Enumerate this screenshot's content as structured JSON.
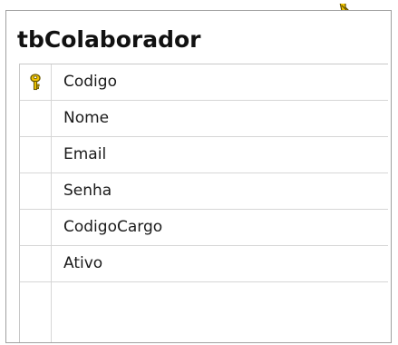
{
  "table": {
    "title": "tbColaborador",
    "columns": [
      {
        "name": "Codigo",
        "primary_key": true,
        "icon": "key-icon"
      },
      {
        "name": "Nome",
        "primary_key": false
      },
      {
        "name": "Email",
        "primary_key": false
      },
      {
        "name": "Senha",
        "primary_key": false
      },
      {
        "name": "CodigoCargo",
        "primary_key": false
      },
      {
        "name": "Ativo",
        "primary_key": false
      }
    ]
  },
  "colors": {
    "key_fill": "#f2c500",
    "key_outline": "#6b5a00",
    "border": "#a0a0a0",
    "grid_line": "#d6d6d6"
  }
}
